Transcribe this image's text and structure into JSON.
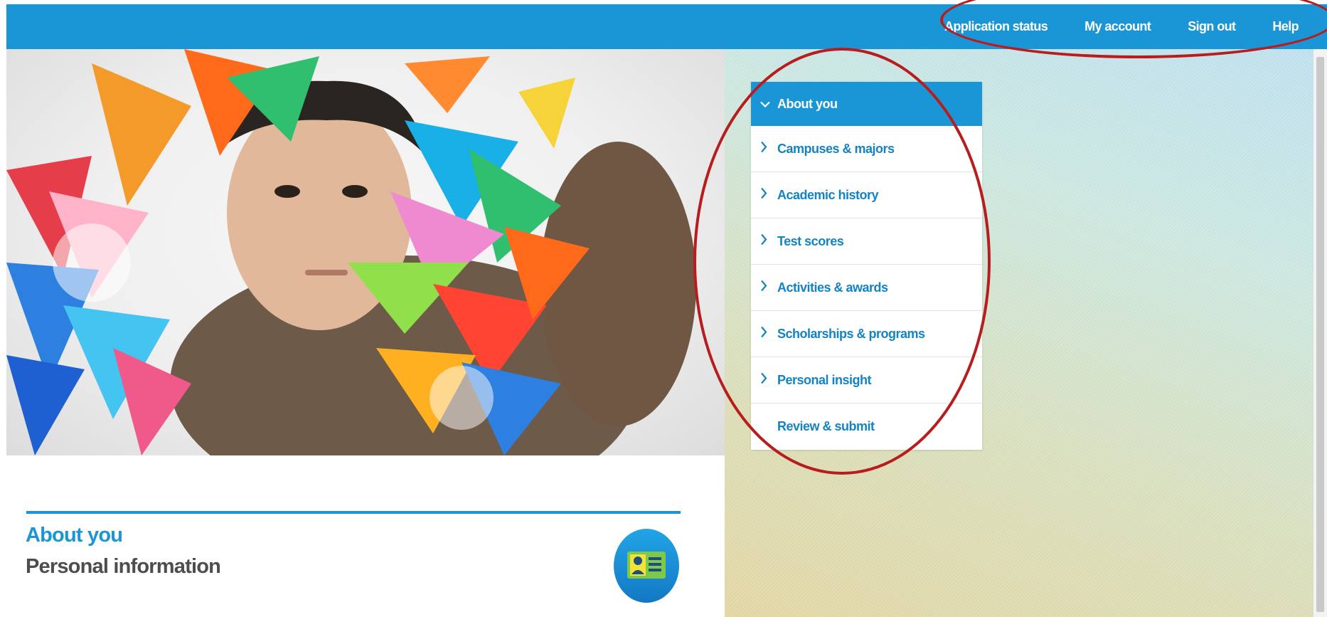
{
  "header": {
    "nav": [
      {
        "label": "Application status"
      },
      {
        "label": "My account"
      },
      {
        "label": "Sign out"
      },
      {
        "label": "Help"
      }
    ]
  },
  "sidebar": {
    "items": [
      {
        "label": "About you",
        "state": "expanded",
        "icon": "chevron-down-icon"
      },
      {
        "label": "Campuses & majors",
        "icon": "chevron-right-icon"
      },
      {
        "label": "Academic history",
        "icon": "chevron-right-icon"
      },
      {
        "label": "Test scores",
        "icon": "chevron-right-icon"
      },
      {
        "label": "Activities & awards",
        "icon": "chevron-right-icon"
      },
      {
        "label": "Scholarships & programs",
        "icon": "chevron-right-icon"
      },
      {
        "label": "Personal insight",
        "icon": "chevron-right-icon"
      },
      {
        "label": "Review & submit",
        "icon": ""
      }
    ]
  },
  "section": {
    "title": "About you",
    "subtitle": "Personal information",
    "icon": "id-card-icon"
  },
  "colors": {
    "brand_blue": "#1a96d6",
    "link_blue": "#1383c3",
    "annotation_red": "#b81c1c"
  }
}
